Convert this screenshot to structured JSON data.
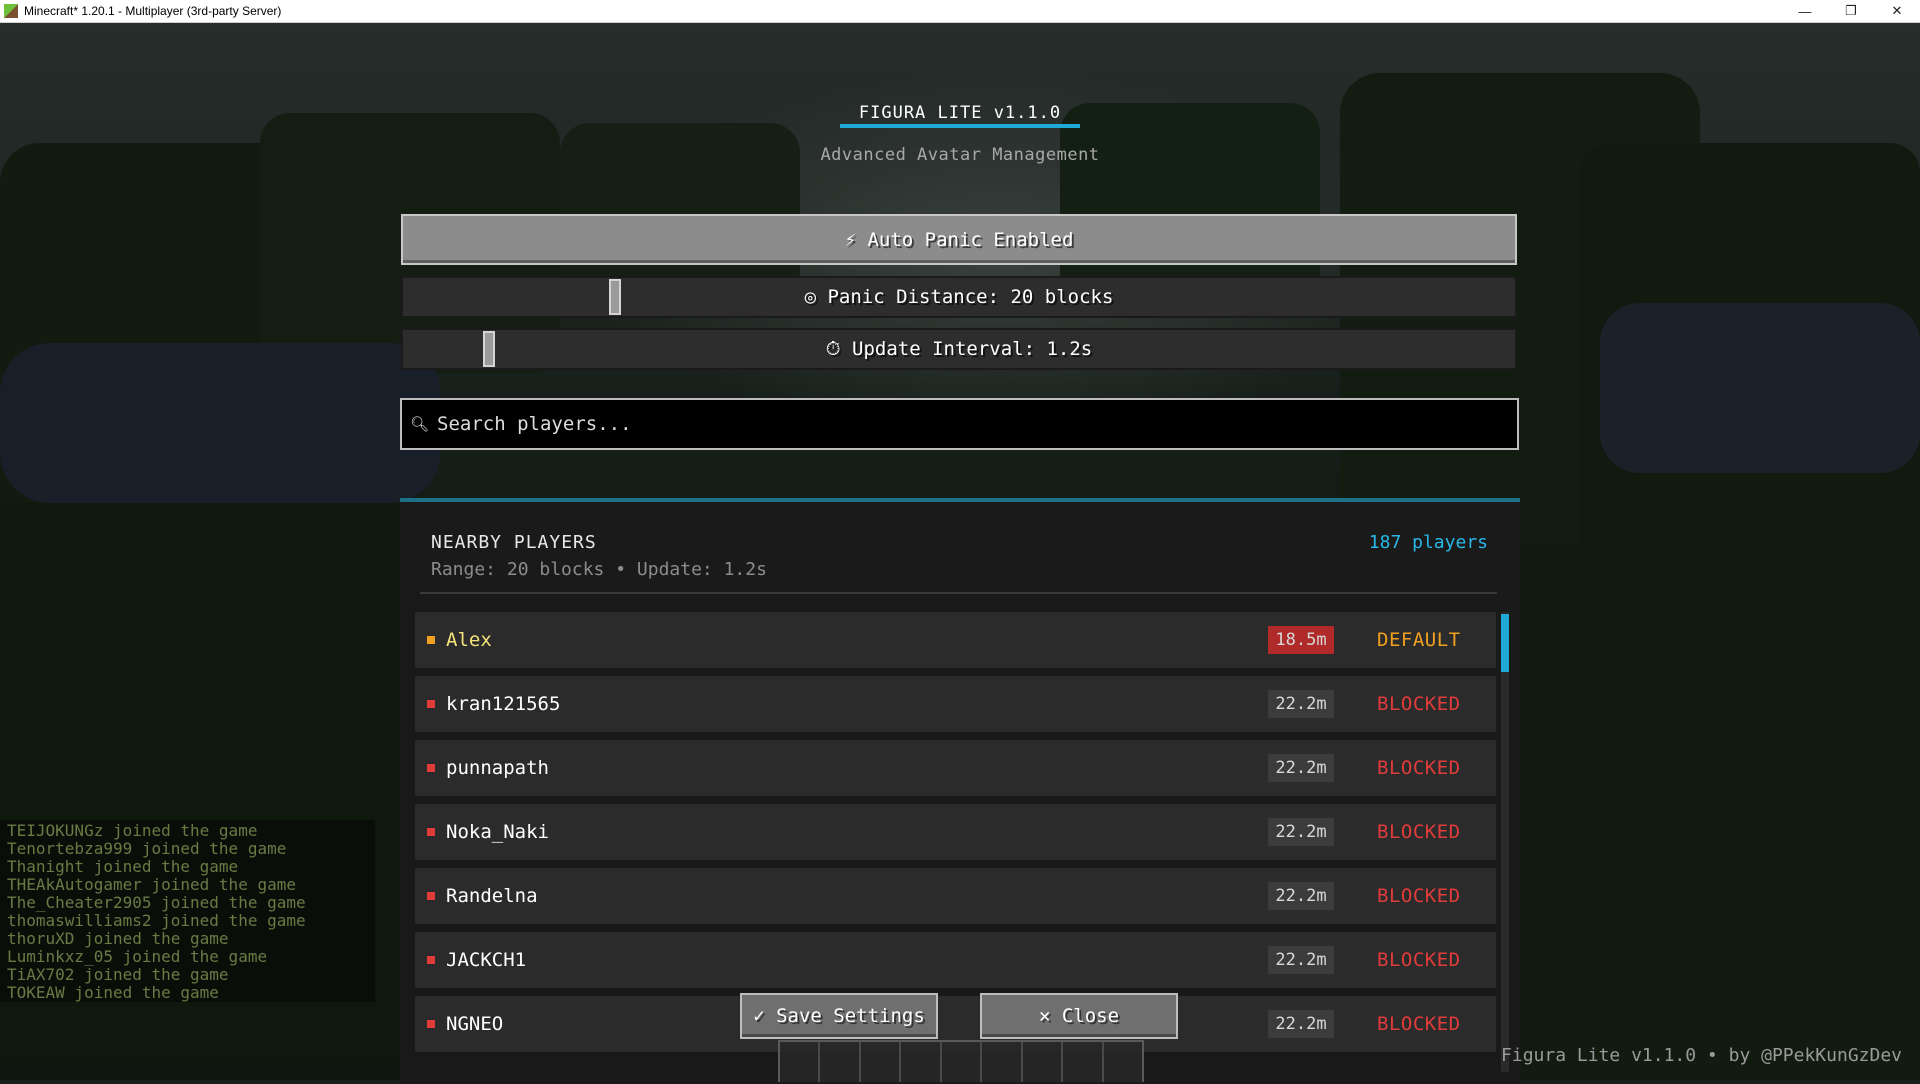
{
  "window": {
    "title": "Minecraft* 1.20.1 - Multiplayer (3rd-party Server)",
    "controls": {
      "minimize": "—",
      "restore": "❐",
      "close": "✕"
    }
  },
  "header": {
    "title": "FIGURA LITE v1.1.0",
    "subtitle": "Advanced Avatar Management"
  },
  "controls": {
    "auto_panic_label": "⚡ Auto Panic Enabled",
    "panic_distance_label": "◎ Panic Distance: 20 blocks",
    "panic_distance_value": 20,
    "update_interval_label": "⏱ Update Interval: 1.2s",
    "update_interval_value": 1.2
  },
  "search": {
    "icon": "search-icon",
    "placeholder": "Search players..."
  },
  "players_panel": {
    "title": "NEARBY PLAYERS",
    "subtitle": "Range: 20 blocks  •  Update: 1.2s",
    "count": "187 players",
    "players": [
      {
        "name": "Alex",
        "distance": "18.5m",
        "status": "DEFAULT",
        "name_color": "#f2e27a",
        "status_color": "#f0a020",
        "bullet_color": "#f0a020",
        "dist_bg": "#b02a2a"
      },
      {
        "name": "kran121565",
        "distance": "22.2m",
        "status": "BLOCKED",
        "name_color": "#ffffff",
        "status_color": "#e23b3b",
        "bullet_color": "#e23b3b",
        "dist_bg": "#3c3c3c"
      },
      {
        "name": "punnapath",
        "distance": "22.2m",
        "status": "BLOCKED",
        "name_color": "#ffffff",
        "status_color": "#e23b3b",
        "bullet_color": "#e23b3b",
        "dist_bg": "#3c3c3c"
      },
      {
        "name": "Noka_Naki",
        "distance": "22.2m",
        "status": "BLOCKED",
        "name_color": "#ffffff",
        "status_color": "#e23b3b",
        "bullet_color": "#e23b3b",
        "dist_bg": "#3c3c3c"
      },
      {
        "name": "Randelna",
        "distance": "22.2m",
        "status": "BLOCKED",
        "name_color": "#ffffff",
        "status_color": "#e23b3b",
        "bullet_color": "#e23b3b",
        "dist_bg": "#3c3c3c"
      },
      {
        "name": "JACKCH1",
        "distance": "22.2m",
        "status": "BLOCKED",
        "name_color": "#ffffff",
        "status_color": "#e23b3b",
        "bullet_color": "#e23b3b",
        "dist_bg": "#3c3c3c"
      },
      {
        "name": "NGNEO",
        "distance": "22.2m",
        "status": "BLOCKED",
        "name_color": "#ffffff",
        "status_color": "#e23b3b",
        "bullet_color": "#e23b3b",
        "dist_bg": "#3c3c3c"
      }
    ]
  },
  "footer": {
    "save_label": "✓ Save Settings",
    "close_label": "✕ Close",
    "watermark": "Figura Lite v1.1.0  •  by @PPekKunGzDev"
  },
  "chat": [
    "TEIJOKUNGz joined the game",
    "Tenortebza999 joined the game",
    "Thanight joined the game",
    "THEAkAutogamer joined the game",
    "The_Cheater2905 joined the game",
    "thomaswilliams2 joined the game",
    "thoruXD joined the game",
    "Luminkxz_05 joined the game",
    "TiAX702 joined the game",
    "TOKEAW joined the game"
  ],
  "colors": {
    "accent": "#1fa9d6",
    "blocked": "#e23b3b",
    "default": "#f0a020"
  }
}
